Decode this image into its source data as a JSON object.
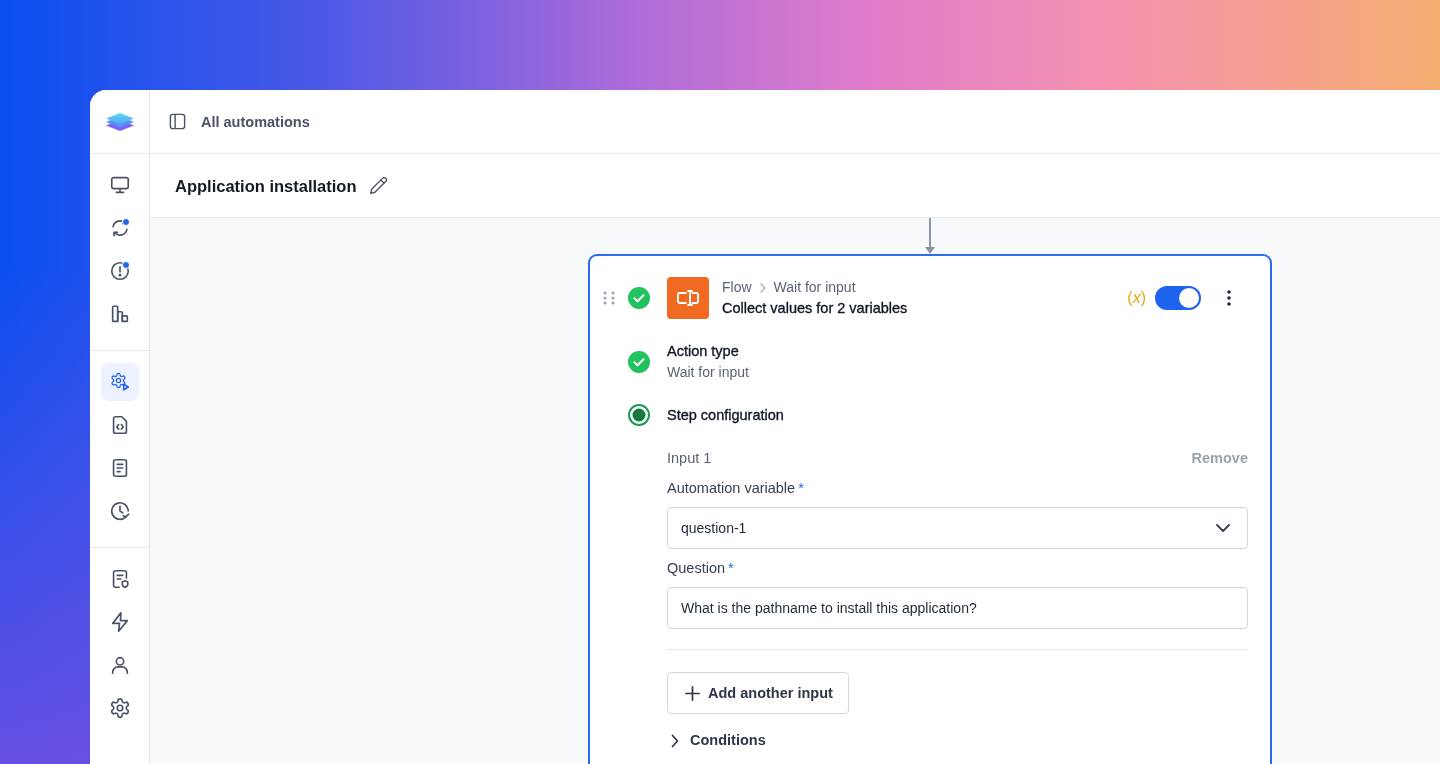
{
  "sidebar": {
    "groups": [
      {
        "items": [
          {
            "selected": false,
            "notification": false
          },
          {
            "selected": false,
            "notification": true
          },
          {
            "selected": false,
            "notification": true
          },
          {
            "selected": false,
            "notification": false
          }
        ]
      },
      {
        "items": [
          {
            "selected": true,
            "notification": false
          },
          {
            "selected": false,
            "notification": false
          },
          {
            "selected": false,
            "notification": false
          },
          {
            "selected": false,
            "notification": false
          }
        ]
      },
      {
        "items": [
          {
            "selected": false,
            "notification": false
          },
          {
            "selected": false,
            "notification": false
          },
          {
            "selected": false,
            "notification": false
          },
          {
            "selected": false,
            "notification": false
          }
        ]
      }
    ]
  },
  "top_bar": {
    "link": "All automations"
  },
  "title_bar": {
    "title": "Application installation"
  },
  "step": {
    "completed": true,
    "breadcrumb": [
      "Flow",
      "Wait for input"
    ],
    "title": "Collect values for 2 variables",
    "variables_button": "(*x*)",
    "enabled": true,
    "sections": [
      {
        "completed": true,
        "title": "Action type",
        "subtitle": "Wait for input"
      },
      {
        "completed": false,
        "title": "Step configuration",
        "inputs": [
          {
            "label": "Input 1",
            "remove": "Remove",
            "fields": [
              {
                "kind": "select",
                "label": "Automation variable",
                "required_mark": "*",
                "value": "question-1"
              },
              {
                "kind": "text",
                "label": "Question",
                "required_mark": "*",
                "value": "What is the pathname to install this application?"
              }
            ]
          }
        ],
        "add_button": "Add another input",
        "conditions": {
          "label": "Conditions",
          "expanded": false
        }
      }
    ]
  }
}
